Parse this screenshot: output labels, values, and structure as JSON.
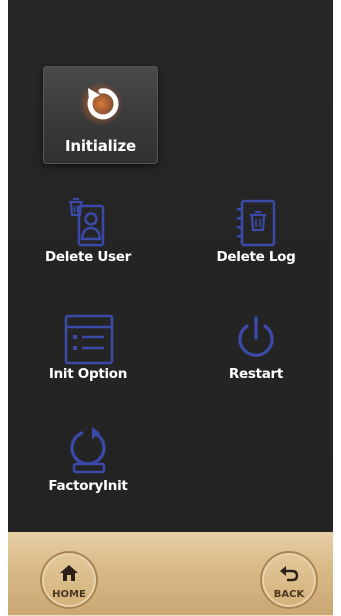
{
  "menu": {
    "initialize": {
      "label": "Initialize",
      "icon": "refresh-icon"
    },
    "delete_user": {
      "label": "Delete User",
      "icon": "delete-user-icon"
    },
    "delete_log": {
      "label": "Delete Log",
      "icon": "delete-log-icon"
    },
    "init_option": {
      "label": "Init Option",
      "icon": "list-option-icon"
    },
    "restart": {
      "label": "Restart",
      "icon": "power-icon"
    },
    "factory_init": {
      "label": "FactoryInit",
      "icon": "factory-reset-icon"
    }
  },
  "footer": {
    "home_label": "HOME",
    "back_label": "BACK"
  },
  "colors": {
    "background": "#252525",
    "icon_blue": "#3b4aa8",
    "initialize_glow": "#ff7a2a",
    "footer_gold": "#d8b986"
  }
}
